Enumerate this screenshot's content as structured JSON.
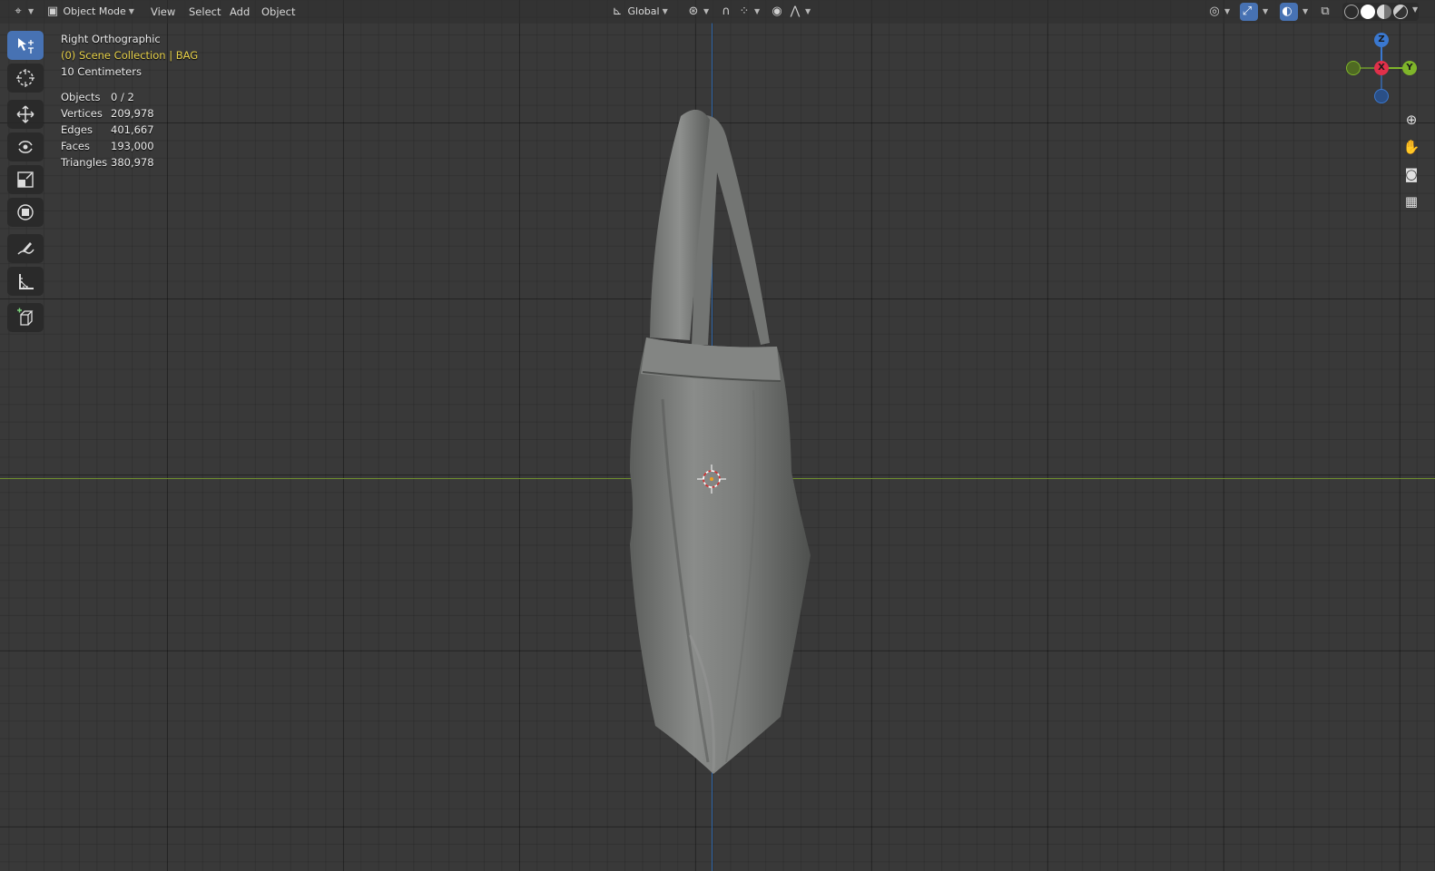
{
  "header": {
    "editor_type_icon": "3d-viewport-icon",
    "mode": "Object Mode",
    "menus": [
      "View",
      "Select",
      "Add",
      "Object"
    ],
    "transform_orientation": "Global",
    "icons": {
      "pivot": "pivot-point-icon",
      "snap": "snap-icon",
      "proportional": "proportional-editing-icon",
      "visibility": "object-visibility-icon",
      "gizmos": "gizmos-icon",
      "overlays": "overlays-icon",
      "xray": "xray-icon",
      "shading_wire": "wireframe-shading-icon",
      "shading_solid": "solid-shading-icon",
      "shading_material": "material-preview-icon",
      "shading_rendered": "rendered-shading-icon"
    }
  },
  "toolbar": {
    "tools": [
      "select-box",
      "cursor",
      "move",
      "rotate",
      "scale",
      "transform",
      "annotate",
      "measure",
      "add-cube"
    ],
    "active": "select-box"
  },
  "viewport": {
    "view_name": "Right Orthographic",
    "collection": "(0) Scene Collection | BAG",
    "grid_scale": "10 Centimeters",
    "stats": [
      {
        "label": "Objects",
        "value": "0 / 2"
      },
      {
        "label": "Vertices",
        "value": "209,978"
      },
      {
        "label": "Edges",
        "value": "401,667"
      },
      {
        "label": "Faces",
        "value": "193,000"
      },
      {
        "label": "Triangles",
        "value": "380,978"
      }
    ]
  },
  "gizmo": {
    "axes": [
      "Z",
      "X",
      "Y"
    ],
    "colors": {
      "x": "#e0304a",
      "y": "#7fb52a",
      "z": "#3a78d0"
    }
  },
  "nav_buttons": [
    "zoom-icon",
    "pan-hand-icon",
    "camera-view-icon",
    "orthographic-grid-icon"
  ],
  "colors": {
    "accent": "#4772b3",
    "collection_text": "#e8d24a",
    "axis_x_line": "#6f8f2e",
    "axis_z_line": "#2e66a8"
  }
}
